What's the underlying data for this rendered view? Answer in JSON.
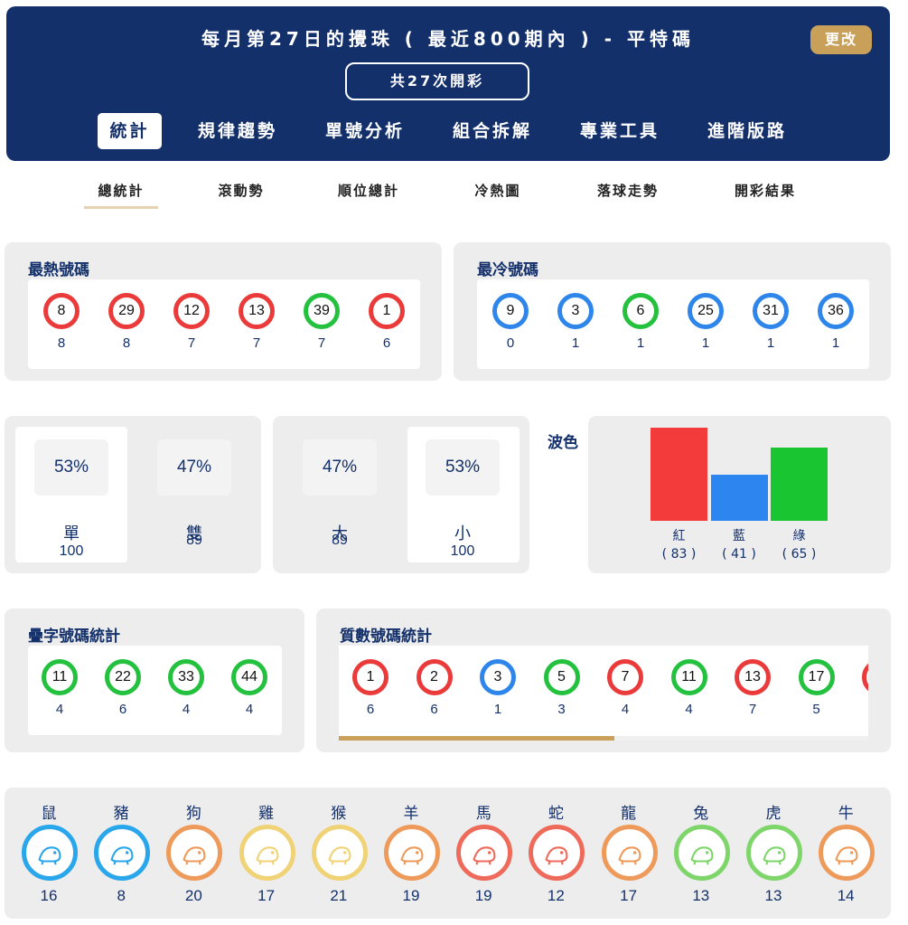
{
  "header": {
    "title": "每月第27日的攪珠 ( 最近800期內 ) - 平特碼",
    "change_label": "更改",
    "count_label": "共27次開彩",
    "tabs": [
      "統計",
      "規律趨勢",
      "單號分析",
      "組合拆解",
      "專業工具",
      "進階版路"
    ]
  },
  "subtabs": [
    "總統計",
    "滾動勢",
    "順位總計",
    "冷熱圖",
    "落球走勢",
    "開彩結果"
  ],
  "hot": {
    "title": "最熱號碼",
    "balls": [
      {
        "n": "8",
        "c": "8",
        "color": "red"
      },
      {
        "n": "29",
        "c": "8",
        "color": "red"
      },
      {
        "n": "12",
        "c": "7",
        "color": "red"
      },
      {
        "n": "13",
        "c": "7",
        "color": "red"
      },
      {
        "n": "39",
        "c": "7",
        "color": "green"
      },
      {
        "n": "1",
        "c": "6",
        "color": "red"
      }
    ]
  },
  "cold": {
    "title": "最冷號碼",
    "balls": [
      {
        "n": "9",
        "c": "0",
        "color": "blue"
      },
      {
        "n": "3",
        "c": "1",
        "color": "blue"
      },
      {
        "n": "6",
        "c": "1",
        "color": "green"
      },
      {
        "n": "25",
        "c": "1",
        "color": "blue"
      },
      {
        "n": "31",
        "c": "1",
        "color": "blue"
      },
      {
        "n": "36",
        "c": "1",
        "color": "blue"
      }
    ]
  },
  "odd_even": [
    {
      "pct": "53%",
      "label": "單",
      "count": "100"
    },
    {
      "pct": "47%",
      "label": "雙",
      "count": "89"
    }
  ],
  "big_small": [
    {
      "pct": "47%",
      "label": "大",
      "count": "89"
    },
    {
      "pct": "53%",
      "label": "小",
      "count": "100"
    }
  ],
  "wave": {
    "title": "波色",
    "bars": [
      {
        "label": "紅",
        "count": "( 83 )",
        "value": 83,
        "color": "#f43b3b"
      },
      {
        "label": "藍",
        "count": "( 41 )",
        "value": 41,
        "color": "#2d86ef"
      },
      {
        "label": "綠",
        "count": "( 65 )",
        "value": 65,
        "color": "#19c631"
      }
    ]
  },
  "double": {
    "title": "疊字號碼統計",
    "balls": [
      {
        "n": "11",
        "c": "4",
        "color": "green"
      },
      {
        "n": "22",
        "c": "6",
        "color": "green"
      },
      {
        "n": "33",
        "c": "4",
        "color": "green"
      },
      {
        "n": "44",
        "c": "4",
        "color": "green"
      }
    ]
  },
  "prime": {
    "title": "質數號碼統計",
    "balls": [
      {
        "n": "1",
        "c": "6",
        "color": "red"
      },
      {
        "n": "2",
        "c": "6",
        "color": "red"
      },
      {
        "n": "3",
        "c": "1",
        "color": "blue"
      },
      {
        "n": "5",
        "c": "3",
        "color": "green"
      },
      {
        "n": "7",
        "c": "4",
        "color": "red"
      },
      {
        "n": "11",
        "c": "4",
        "color": "green"
      },
      {
        "n": "13",
        "c": "7",
        "color": "red"
      },
      {
        "n": "17",
        "c": "5",
        "color": "green"
      },
      {
        "n": "",
        "c": "",
        "color": "red"
      }
    ],
    "scroll_fraction": 0.52
  },
  "zodiac": [
    {
      "name": "鼠",
      "count": "16",
      "icon": "rat-icon",
      "ring": "#2aa6ea"
    },
    {
      "name": "豬",
      "count": "8",
      "icon": "pig-icon",
      "ring": "#2aa6ea"
    },
    {
      "name": "狗",
      "count": "20",
      "icon": "dog-icon",
      "ring": "#ee9a5a"
    },
    {
      "name": "雞",
      "count": "17",
      "icon": "rooster-icon",
      "ring": "#f0d277"
    },
    {
      "name": "猴",
      "count": "21",
      "icon": "monkey-icon",
      "ring": "#f0d277"
    },
    {
      "name": "羊",
      "count": "19",
      "icon": "goat-icon",
      "ring": "#ee9a5a"
    },
    {
      "name": "馬",
      "count": "19",
      "icon": "horse-icon",
      "ring": "#ee6a5a"
    },
    {
      "name": "蛇",
      "count": "12",
      "icon": "snake-icon",
      "ring": "#ee6a5a"
    },
    {
      "name": "龍",
      "count": "17",
      "icon": "dragon-icon",
      "ring": "#ee9a5a"
    },
    {
      "name": "兔",
      "count": "13",
      "icon": "rabbit-icon",
      "ring": "#7ed66a"
    },
    {
      "name": "虎",
      "count": "13",
      "icon": "tiger-icon",
      "ring": "#7ed66a"
    },
    {
      "name": "牛",
      "count": "14",
      "icon": "ox-icon",
      "ring": "#ee9a5a"
    }
  ]
}
